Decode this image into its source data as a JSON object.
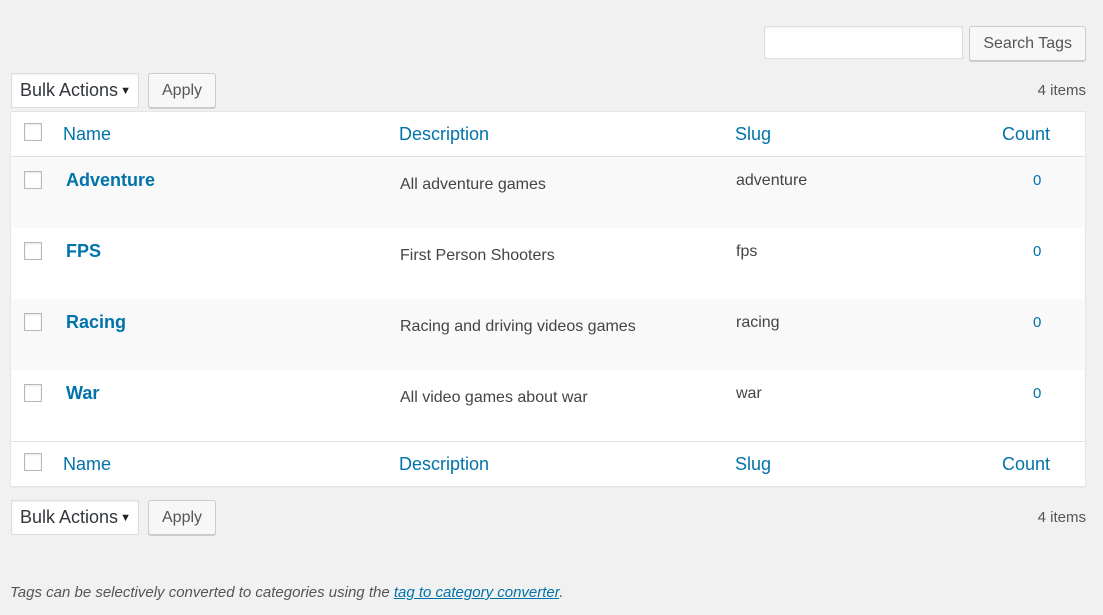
{
  "search": {
    "placeholder": "",
    "value": "",
    "button_label": "Search Tags"
  },
  "tablenav": {
    "bulk_actions_label": "Bulk Actions",
    "apply_label": "Apply",
    "items_count": "4 items"
  },
  "columns": {
    "name": "Name",
    "description": "Description",
    "slug": "Slug",
    "count": "Count"
  },
  "rows": [
    {
      "name": "Adventure",
      "description": "All adventure games",
      "slug": "adventure",
      "count": "0"
    },
    {
      "name": "FPS",
      "description": "First Person Shooters",
      "slug": "fps",
      "count": "0"
    },
    {
      "name": "Racing",
      "description": "Racing and driving videos games",
      "slug": "racing",
      "count": "0"
    },
    {
      "name": "War",
      "description": "All video games about war",
      "slug": "war",
      "count": "0"
    }
  ],
  "footnote": {
    "text": "Tags can be selectively converted to categories using the ",
    "link": "tag to category converter",
    "end": "."
  },
  "colors": {
    "link": "#0073aa",
    "background": "#f1f1f1"
  }
}
